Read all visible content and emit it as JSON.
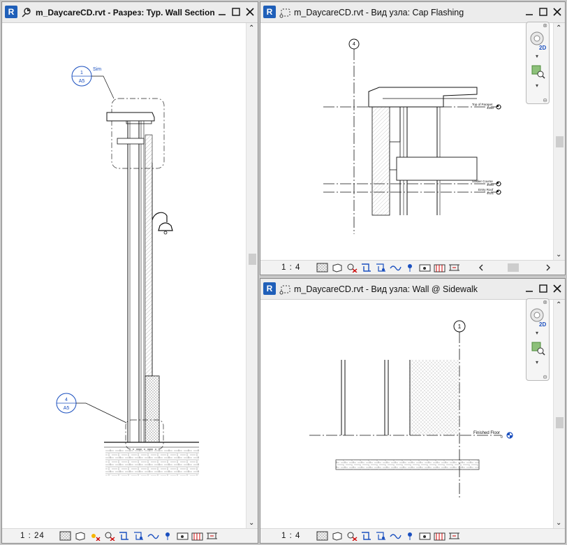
{
  "windows": {
    "left": {
      "title": "m_DaycareCD.rvt - Разрез: Typ. Wall Section",
      "scale": "1 : 24"
    },
    "top_right": {
      "title": "m_DaycareCD.rvt - Вид узла: Cap Flashing",
      "scale": "1 : 4"
    },
    "bottom_right": {
      "title": "m_DaycareCD.rvt - Вид узла: Wall @ Sidewalk",
      "scale": "1 : 4"
    }
  },
  "app_logo": "R",
  "navbar": {
    "mode_label": "2D"
  },
  "left_drawing": {
    "callout_top": {
      "number": "1",
      "sheet": "A5",
      "note": "Sim"
    },
    "callout_bottom": {
      "number": "4",
      "sheet": "A5"
    }
  },
  "cap_drawing": {
    "grid": "4",
    "levels": [
      {
        "name": "Top of Parapet",
        "elev": "4250"
      },
      {
        "name": "Soldier Course",
        "elev": "4090"
      },
      {
        "name": "Entry Roof",
        "elev": "4021"
      }
    ]
  },
  "sidewalk_drawing": {
    "grid": "1",
    "level": {
      "name": "Finished Floor",
      "elev": "0"
    }
  },
  "icons": [
    "window-restore-icon",
    "minimize-icon",
    "maximize-icon",
    "close-icon",
    "view-section-icon",
    "view-detail-icon"
  ],
  "colors": {
    "revit_blue": "#1f5fb9",
    "callout_blue": "#1a4fbf"
  }
}
